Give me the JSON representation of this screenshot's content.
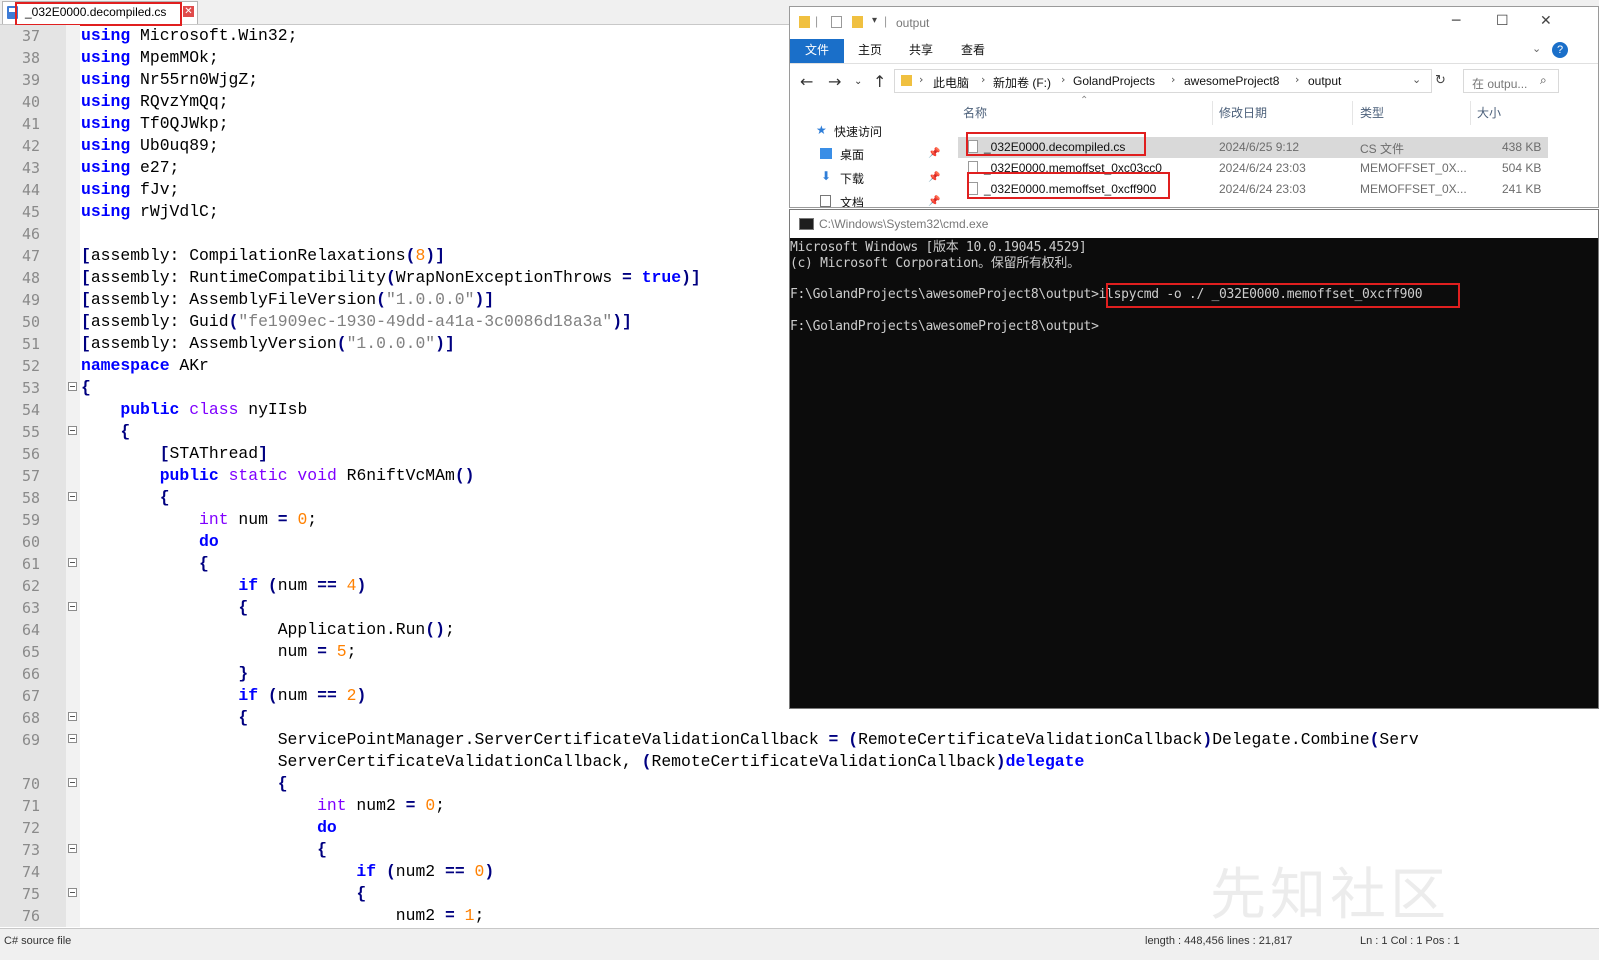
{
  "editor": {
    "tab_label": "_032E0000.decompiled.cs",
    "lines": [
      {
        "n": "37",
        "code": [
          {
            "t": "kw",
            "v": "using"
          },
          {
            "t": "p",
            "v": " Microsoft.Win32;"
          }
        ]
      },
      {
        "n": "38",
        "code": [
          {
            "t": "kw",
            "v": "using"
          },
          {
            "t": "p",
            "v": " MpemMOk;"
          }
        ]
      },
      {
        "n": "39",
        "code": [
          {
            "t": "kw",
            "v": "using"
          },
          {
            "t": "p",
            "v": " Nr55rn0WjgZ;"
          }
        ]
      },
      {
        "n": "40",
        "code": [
          {
            "t": "kw",
            "v": "using"
          },
          {
            "t": "p",
            "v": " RQvzYmQq;"
          }
        ]
      },
      {
        "n": "41",
        "code": [
          {
            "t": "kw",
            "v": "using"
          },
          {
            "t": "p",
            "v": " Tf0QJWkp;"
          }
        ]
      },
      {
        "n": "42",
        "code": [
          {
            "t": "kw",
            "v": "using"
          },
          {
            "t": "p",
            "v": " Ub0uq89;"
          }
        ]
      },
      {
        "n": "43",
        "code": [
          {
            "t": "kw",
            "v": "using"
          },
          {
            "t": "p",
            "v": " e27;"
          }
        ]
      },
      {
        "n": "44",
        "code": [
          {
            "t": "kw",
            "v": "using"
          },
          {
            "t": "p",
            "v": " fJv;"
          }
        ]
      },
      {
        "n": "45",
        "code": [
          {
            "t": "kw",
            "v": "using"
          },
          {
            "t": "p",
            "v": " rWjVdlC;"
          }
        ]
      },
      {
        "n": "46",
        "code": []
      },
      {
        "n": "47",
        "code": [
          {
            "t": "op",
            "v": "["
          },
          {
            "t": "p",
            "v": "assembly: CompilationRelaxations"
          },
          {
            "t": "op",
            "v": "("
          },
          {
            "t": "num",
            "v": "8"
          },
          {
            "t": "op",
            "v": ")]"
          }
        ]
      },
      {
        "n": "48",
        "code": [
          {
            "t": "op",
            "v": "["
          },
          {
            "t": "p",
            "v": "assembly: RuntimeCompatibility"
          },
          {
            "t": "op",
            "v": "("
          },
          {
            "t": "p",
            "v": "WrapNonExceptionThrows "
          },
          {
            "t": "op",
            "v": "="
          },
          {
            "t": "p",
            "v": " "
          },
          {
            "t": "kw",
            "v": "true"
          },
          {
            "t": "op",
            "v": ")]"
          }
        ]
      },
      {
        "n": "49",
        "code": [
          {
            "t": "op",
            "v": "["
          },
          {
            "t": "p",
            "v": "assembly: AssemblyFileVersion"
          },
          {
            "t": "op",
            "v": "("
          },
          {
            "t": "str",
            "v": "\"1.0.0.0\""
          },
          {
            "t": "op",
            "v": ")]"
          }
        ]
      },
      {
        "n": "50",
        "code": [
          {
            "t": "op",
            "v": "["
          },
          {
            "t": "p",
            "v": "assembly: Guid"
          },
          {
            "t": "op",
            "v": "("
          },
          {
            "t": "str",
            "v": "\"fe1909ec-1930-49dd-a41a-3c0086d18a3a\""
          },
          {
            "t": "op",
            "v": ")]"
          }
        ]
      },
      {
        "n": "51",
        "code": [
          {
            "t": "op",
            "v": "["
          },
          {
            "t": "p",
            "v": "assembly: AssemblyVersion"
          },
          {
            "t": "op",
            "v": "("
          },
          {
            "t": "str",
            "v": "\"1.0.0.0\""
          },
          {
            "t": "op",
            "v": ")]"
          }
        ]
      },
      {
        "n": "52",
        "code": [
          {
            "t": "kw",
            "v": "namespace"
          },
          {
            "t": "p",
            "v": " AKr"
          }
        ]
      },
      {
        "n": "53",
        "code": [
          {
            "t": "op",
            "v": "{"
          }
        ]
      },
      {
        "n": "54",
        "code": [
          {
            "t": "p",
            "v": "    "
          },
          {
            "t": "kw",
            "v": "public"
          },
          {
            "t": "p",
            "v": " "
          },
          {
            "t": "ty",
            "v": "class"
          },
          {
            "t": "p",
            "v": " nyIIsb"
          }
        ]
      },
      {
        "n": "55",
        "code": [
          {
            "t": "p",
            "v": "    "
          },
          {
            "t": "op",
            "v": "{"
          }
        ]
      },
      {
        "n": "56",
        "code": [
          {
            "t": "p",
            "v": "        "
          },
          {
            "t": "op",
            "v": "["
          },
          {
            "t": "p",
            "v": "STAThread"
          },
          {
            "t": "op",
            "v": "]"
          }
        ]
      },
      {
        "n": "57",
        "code": [
          {
            "t": "p",
            "v": "        "
          },
          {
            "t": "kw",
            "v": "public"
          },
          {
            "t": "p",
            "v": " "
          },
          {
            "t": "ty",
            "v": "static void"
          },
          {
            "t": "p",
            "v": " R6niftVcMAm"
          },
          {
            "t": "op",
            "v": "()"
          }
        ]
      },
      {
        "n": "58",
        "code": [
          {
            "t": "p",
            "v": "        "
          },
          {
            "t": "op",
            "v": "{"
          }
        ]
      },
      {
        "n": "59",
        "code": [
          {
            "t": "p",
            "v": "            "
          },
          {
            "t": "ty",
            "v": "int"
          },
          {
            "t": "p",
            "v": " num "
          },
          {
            "t": "op",
            "v": "="
          },
          {
            "t": "p",
            "v": " "
          },
          {
            "t": "num",
            "v": "0"
          },
          {
            "t": "p",
            "v": ";"
          }
        ]
      },
      {
        "n": "60",
        "code": [
          {
            "t": "p",
            "v": "            "
          },
          {
            "t": "kw",
            "v": "do"
          }
        ]
      },
      {
        "n": "61",
        "code": [
          {
            "t": "p",
            "v": "            "
          },
          {
            "t": "op",
            "v": "{"
          }
        ]
      },
      {
        "n": "62",
        "code": [
          {
            "t": "p",
            "v": "                "
          },
          {
            "t": "kw",
            "v": "if"
          },
          {
            "t": "p",
            "v": " "
          },
          {
            "t": "op",
            "v": "("
          },
          {
            "t": "p",
            "v": "num "
          },
          {
            "t": "op",
            "v": "=="
          },
          {
            "t": "p",
            "v": " "
          },
          {
            "t": "num",
            "v": "4"
          },
          {
            "t": "op",
            "v": ")"
          }
        ]
      },
      {
        "n": "63",
        "code": [
          {
            "t": "p",
            "v": "                "
          },
          {
            "t": "op",
            "v": "{"
          }
        ]
      },
      {
        "n": "64",
        "code": [
          {
            "t": "p",
            "v": "                    Application.Run"
          },
          {
            "t": "op",
            "v": "()"
          },
          {
            "t": "p",
            "v": ";"
          }
        ]
      },
      {
        "n": "65",
        "code": [
          {
            "t": "p",
            "v": "                    num "
          },
          {
            "t": "op",
            "v": "="
          },
          {
            "t": "p",
            "v": " "
          },
          {
            "t": "num",
            "v": "5"
          },
          {
            "t": "p",
            "v": ";"
          }
        ]
      },
      {
        "n": "66",
        "code": [
          {
            "t": "p",
            "v": "                "
          },
          {
            "t": "op",
            "v": "}"
          }
        ]
      },
      {
        "n": "67",
        "code": [
          {
            "t": "p",
            "v": "                "
          },
          {
            "t": "kw",
            "v": "if"
          },
          {
            "t": "p",
            "v": " "
          },
          {
            "t": "op",
            "v": "("
          },
          {
            "t": "p",
            "v": "num "
          },
          {
            "t": "op",
            "v": "=="
          },
          {
            "t": "p",
            "v": " "
          },
          {
            "t": "num",
            "v": "2"
          },
          {
            "t": "op",
            "v": ")"
          }
        ]
      },
      {
        "n": "68",
        "code": [
          {
            "t": "p",
            "v": "                "
          },
          {
            "t": "op",
            "v": "{"
          }
        ]
      },
      {
        "n": "69",
        "code": [
          {
            "t": "p",
            "v": "                    ServicePointManager.ServerCertificateValidationCallback "
          },
          {
            "t": "op",
            "v": "="
          },
          {
            "t": "p",
            "v": " "
          },
          {
            "t": "op",
            "v": "("
          },
          {
            "t": "p",
            "v": "RemoteCertificateValidationCallback"
          },
          {
            "t": "op",
            "v": ")"
          },
          {
            "t": "p",
            "v": "Delegate.Combine"
          },
          {
            "t": "op",
            "v": "("
          },
          {
            "t": "p",
            "v": "Serv"
          }
        ]
      },
      {
        "n": "",
        "code": [
          {
            "t": "p",
            "v": "                    ServerCertificateValidationCallback, "
          },
          {
            "t": "op",
            "v": "("
          },
          {
            "t": "p",
            "v": "RemoteCertificateValidationCallback"
          },
          {
            "t": "op",
            "v": ")"
          },
          {
            "t": "kw",
            "v": "delegate"
          }
        ]
      },
      {
        "n": "70",
        "code": [
          {
            "t": "p",
            "v": "                    "
          },
          {
            "t": "op",
            "v": "{"
          }
        ]
      },
      {
        "n": "71",
        "code": [
          {
            "t": "p",
            "v": "                        "
          },
          {
            "t": "ty",
            "v": "int"
          },
          {
            "t": "p",
            "v": " num2 "
          },
          {
            "t": "op",
            "v": "="
          },
          {
            "t": "p",
            "v": " "
          },
          {
            "t": "num",
            "v": "0"
          },
          {
            "t": "p",
            "v": ";"
          }
        ]
      },
      {
        "n": "72",
        "code": [
          {
            "t": "p",
            "v": "                        "
          },
          {
            "t": "kw",
            "v": "do"
          }
        ]
      },
      {
        "n": "73",
        "code": [
          {
            "t": "p",
            "v": "                        "
          },
          {
            "t": "op",
            "v": "{"
          }
        ]
      },
      {
        "n": "74",
        "code": [
          {
            "t": "p",
            "v": "                            "
          },
          {
            "t": "kw",
            "v": "if"
          },
          {
            "t": "p",
            "v": " "
          },
          {
            "t": "op",
            "v": "("
          },
          {
            "t": "p",
            "v": "num2 "
          },
          {
            "t": "op",
            "v": "=="
          },
          {
            "t": "p",
            "v": " "
          },
          {
            "t": "num",
            "v": "0"
          },
          {
            "t": "op",
            "v": ")"
          }
        ]
      },
      {
        "n": "75",
        "code": [
          {
            "t": "p",
            "v": "                            "
          },
          {
            "t": "op",
            "v": "{"
          }
        ]
      },
      {
        "n": "76",
        "code": [
          {
            "t": "p",
            "v": "                                num2 "
          },
          {
            "t": "op",
            "v": "="
          },
          {
            "t": "p",
            "v": " "
          },
          {
            "t": "num",
            "v": "1"
          },
          {
            "t": "p",
            "v": ";"
          }
        ]
      }
    ],
    "status": {
      "left": "C# source file",
      "length": "length : 448,456   lines : 21,817",
      "position": "Ln : 1    Col : 1    Pos : 1"
    }
  },
  "explorer": {
    "title": "output",
    "ribbon_tabs": [
      "文件",
      "主页",
      "共享",
      "查看"
    ],
    "breadcrumbs": [
      "此电脑",
      "新加卷 (F:)",
      "GolandProjects",
      "awesomeProject8",
      "output"
    ],
    "search_placeholder": "在 outpu...",
    "nav_items": [
      "快速访问",
      "桌面",
      "下载",
      "文档"
    ],
    "columns": [
      "名称",
      "修改日期",
      "类型",
      "大小"
    ],
    "files": [
      {
        "name": "_032E0000.decompiled.cs",
        "date": "2024/6/25 9:12",
        "type": "CS 文件",
        "size": "438 KB"
      },
      {
        "name": "_032E0000.memoffset_0xc03cc0",
        "date": "2024/6/24 23:03",
        "type": "MEMOFFSET_0X...",
        "size": "504 KB"
      },
      {
        "name": "_032E0000.memoffset_0xcff900",
        "date": "2024/6/24 23:03",
        "type": "MEMOFFSET_0X...",
        "size": "241 KB"
      }
    ]
  },
  "cmd": {
    "title": "C:\\Windows\\System32\\cmd.exe",
    "line1": "Microsoft Windows [版本 10.0.19045.4529]",
    "line2": "(c) Microsoft Corporation。保留所有权利。",
    "prompt1": "F:\\GolandProjects\\awesomeProject8\\output>",
    "command": "ilspycmd -o ./ _032E0000.memoffset_0xcff900",
    "prompt2": "F:\\GolandProjects\\awesomeProject8\\output>"
  },
  "watermark": "先知社区",
  "colors": {
    "highlight": "#e01f1f",
    "ribbon_file": "#1a6fc9",
    "keyword": "#0000ff",
    "type": "#8000ff",
    "number": "#ff8000"
  }
}
